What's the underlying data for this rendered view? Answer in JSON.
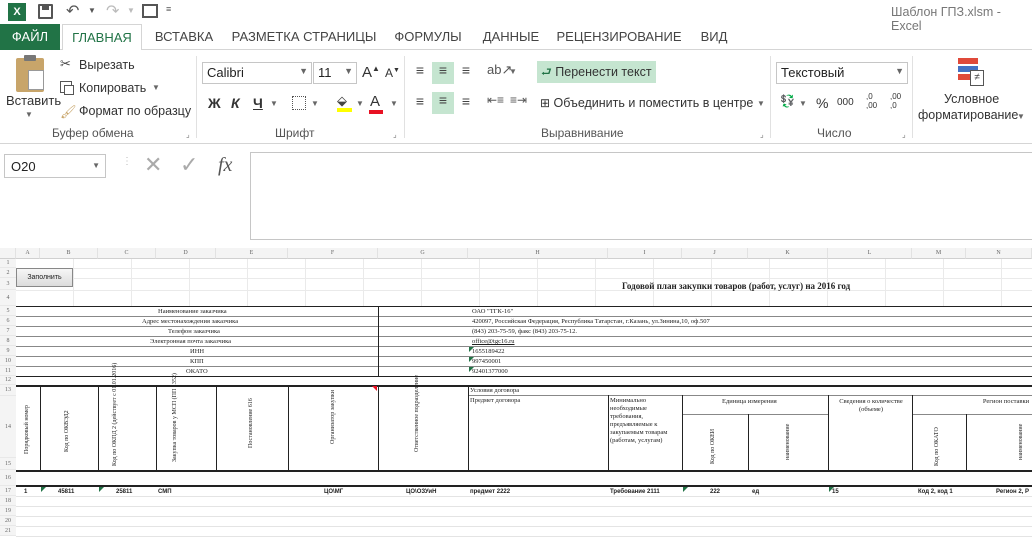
{
  "titlebar": {
    "title": "Шаблон ГПЗ.xlsm - Excel"
  },
  "tabs": [
    {
      "label": "ФАЙЛ"
    },
    {
      "label": "ГЛАВНАЯ"
    },
    {
      "label": "ВСТАВКА"
    },
    {
      "label": "РАЗМЕТКА СТРАНИЦЫ"
    },
    {
      "label": "ФОРМУЛЫ"
    },
    {
      "label": "ДАННЫЕ"
    },
    {
      "label": "РЕЦЕНЗИРОВАНИЕ"
    },
    {
      "label": "ВИД"
    }
  ],
  "clipboard": {
    "paste": "Вставить",
    "cut": "Вырезать",
    "copy": "Копировать",
    "format_painter": "Формат по образцу",
    "group": "Буфер обмена"
  },
  "font": {
    "name": "Calibri",
    "size": "11",
    "bold": "Ж",
    "italic": "К",
    "underline": "Ч",
    "group": "Шрифт",
    "grow": "A",
    "shrink": "A"
  },
  "alignment": {
    "wrap": "Перенести текст",
    "merge": "Объединить и поместить в центре",
    "group": "Выравнивание"
  },
  "number": {
    "format": "Текстовый",
    "percent": "%",
    "thousands": "000",
    "inc_decimal": ",0\n,00",
    "dec_decimal": ",00\n,0",
    "group": "Число"
  },
  "styles": {
    "conditional": "Условное",
    "conditional2": "форматирование"
  },
  "formula_bar": {
    "name_box": "O20",
    "fx": "fx"
  },
  "colors": {
    "excel_green": "#217346",
    "font_red": "#e81123",
    "fill_yellow": "#ffff00"
  },
  "sheet": {
    "columns": [
      "A",
      "B",
      "C",
      "D",
      "E",
      "F",
      "G",
      "H",
      "I",
      "J",
      "K",
      "L",
      "M",
      "N"
    ],
    "rows": [
      "1",
      "2",
      "3",
      "4",
      "5",
      "6",
      "7",
      "8",
      "9",
      "10",
      "11",
      "12",
      "13",
      "14",
      "15",
      "16",
      "17",
      "18",
      "19",
      "20",
      "21"
    ],
    "fill_button": "Заполнить",
    "title": "Годовой план закупки товаров (работ, услуг) на 2016 год",
    "info": [
      {
        "label": "Наименование заказчика",
        "value": "ОАО \"ТГК-16\""
      },
      {
        "label": "Адрес местонахождения заказчика",
        "value": "420097, Российская Федерация, Республика Татарстан, г.Казань, ул.Зинина,10, оф.507"
      },
      {
        "label": "Телефон заказчика",
        "value": "(843) 203-75-59, факс (843) 203-75-12."
      },
      {
        "label": "Электронная почта заказчика",
        "value": "office@tgc16.ru"
      },
      {
        "label": "ИНН",
        "value": "1655189422"
      },
      {
        "label": "КПП",
        "value": "997450001"
      },
      {
        "label": "ОКАТО",
        "value": "92401377000"
      }
    ],
    "headers": {
      "serial": "Порядковый номер",
      "okved": "Код по ОКВЭД2",
      "okdp": "Код по ОКПД 2 (действует с 01.01.2016)",
      "purchase_type": "Закупка товаров у МСП (ПП 1352)",
      "resolution": "Постановление 616",
      "organizer": "Организатор закупки",
      "responsible": "Ответственное подразделение",
      "conditions": "Условия договора",
      "subject": "Предмет договора",
      "requirements": "Минимально необходимые требования, предъявляемые к закупаемым товарам (работам, услугам)",
      "unit": "Единица измерения",
      "okei": "Код по ОКЕИ",
      "unit_name": "наименование",
      "quantity": "Сведения о количестве (объеме)",
      "region": "Регион поставки",
      "okato": "Код по ОКАТО",
      "region_name": "наименование"
    },
    "row17": {
      "serial": "1",
      "okved": "45811",
      "okdp": "25811",
      "purchase_type": "СМП",
      "organizer": "ЦО\\МГ",
      "responsible": "ЦО\\ОЗУиН",
      "subject": "предмет 2222",
      "requirements": "Требование 2111",
      "okei": "222",
      "unit_name": "ед",
      "quantity": "15",
      "okato": "Код 2, код 1",
      "region": "Регион 2, Р"
    }
  }
}
